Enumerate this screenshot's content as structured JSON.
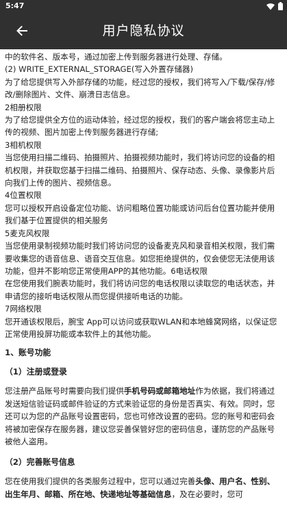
{
  "status_bar": {
    "time": "5:47",
    "icons": [
      "wifi-icon",
      "battery-icon"
    ]
  },
  "app_bar": {
    "back_icon": "arrow-left-icon",
    "title": "用户隐私协议"
  },
  "content": {
    "lines": [
      "中的软件名、版本号，通过加密上传到服务器进行处理、存储。",
      "(2) WRITE_EXTERNAL_STORAGE(写入外置存储器)",
      "为了给您提供写入外部存储的功能，经过您的授权，我们将写入/下载/保存/修改/删除图片、文件、崩溃日志信息。",
      "2相册权限",
      "为了给您提供全方位的运动体验，经过您的授权，我们的客户端会将您主动上传的视频、图片加密上传到服务器进行存储;",
      "3相机权限",
      "当您使用扫描二维码、拍摄照片、拍摄视频功能时，我们将访问您的设备的相机权限，并获取您基于扫描二维码、拍摄照片、保存动态、头像、录像影片后向我们上传的图片、视频信息。",
      "4位置权限",
      "您可以授权开启设备定位功能、访问粗略位置功能或访问后台位置功能并使用我们基于位置提供的相关服务",
      "5麦克风权限",
      "当您使用录制视频功能时我们将访问您的设备麦克风和录音相关权限，我们需要收集您的语音信息、语音交互信息。如您拒绝提供的，仅会使您无法使用该功能，但并不影响您正常使用APP的其他功能。6电话权限",
      "在您使用我们腕表功能时，我们将访问您的电话权限以读取您的电话状态，并申请您的接听电话权限从而您提供接听电话的功能。",
      "7网络权限",
      "您开通该权限后，腕宝 App可以访问或获取WLAN和本地蜂窝网络，以保证您正常使用投屏功能或本软件上的其他功能。"
    ],
    "section1_heading": "1、账号功能",
    "section1_1_heading": "（1）注册或登录",
    "section1_1_text_a": "您注册产品账号时需要向我们提供",
    "section1_1_bold": "手机号码或邮箱地址",
    "section1_1_text_b": "作为依据，我们将通过发送短信验证码或邮件验证的方式来验证您的身份是否真实、有效。同时，您还可以为您的产品账号设置密码，您也可修改设置的密码。您的账号和密码会将被加密保存在服务器，建议您妥善保管好您的密码信息，谨防您的产品账号被他人盗用。",
    "section1_2_heading": "（2）完善账号信息",
    "section1_2_text_a": "您在使用我们提供的各类服务过程中，您可以通过完善",
    "section1_2_bold": "头像、用户名、性别、出生年月、邮箱、所在地、快递地址等基础信息",
    "section1_2_text_b": "，及在必要时，您可"
  }
}
